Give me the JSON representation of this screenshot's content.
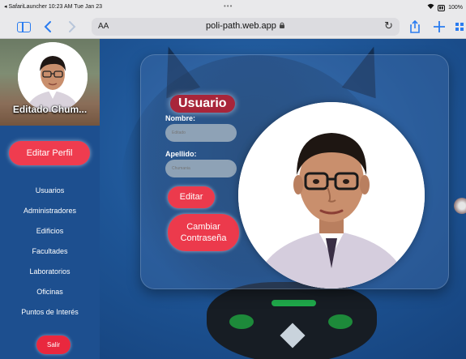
{
  "status_bar": {
    "left_text": "◂ SafariLauncher  10:23 AM  Tue Jan 23",
    "center_dots": "•••",
    "battery": "100%"
  },
  "browser": {
    "aa_label": "AA",
    "url": "poli-path.web.app"
  },
  "sidebar": {
    "user_name": "Editado Chum...",
    "edit_profile_label": "Editar Perfil",
    "nav_items": [
      "Usuarios",
      "Administradores",
      "Edificios",
      "Facultades",
      "Laboratorios",
      "Oficinas",
      "Puntos de Interés"
    ],
    "logout_label": "Salir"
  },
  "card": {
    "title": "Usuario",
    "first_name_label": "Nombre:",
    "first_name_value": "Editado",
    "last_name_label": "Apellido:",
    "last_name_value": "Chumania",
    "edit_label": "Editar",
    "change_password_line1": "Cambiar",
    "change_password_line2": "Contraseña"
  },
  "colors": {
    "accent_red": "#ec3a4c",
    "sidebar_blue": "#1d4f8f",
    "safari_blue": "#2a7cf0"
  }
}
